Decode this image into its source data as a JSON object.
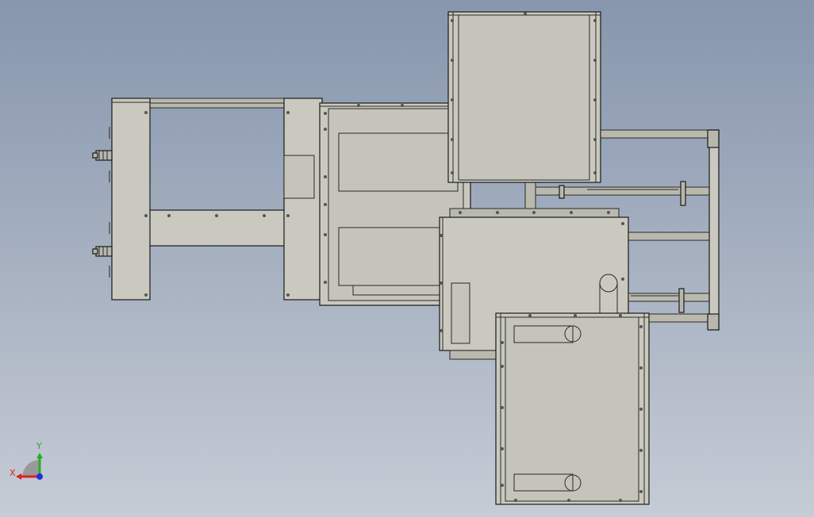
{
  "viewport": {
    "background_top": "#8796ad",
    "background_bottom": "#c6ccd6"
  },
  "triad": {
    "x_label": "X",
    "y_label": "Y",
    "x_color": "#e02020",
    "y_color": "#20b020",
    "z_color": "#2030e0"
  },
  "model": {
    "part_color": "#c9c9bf",
    "edge_color": "#1b1b1b"
  }
}
